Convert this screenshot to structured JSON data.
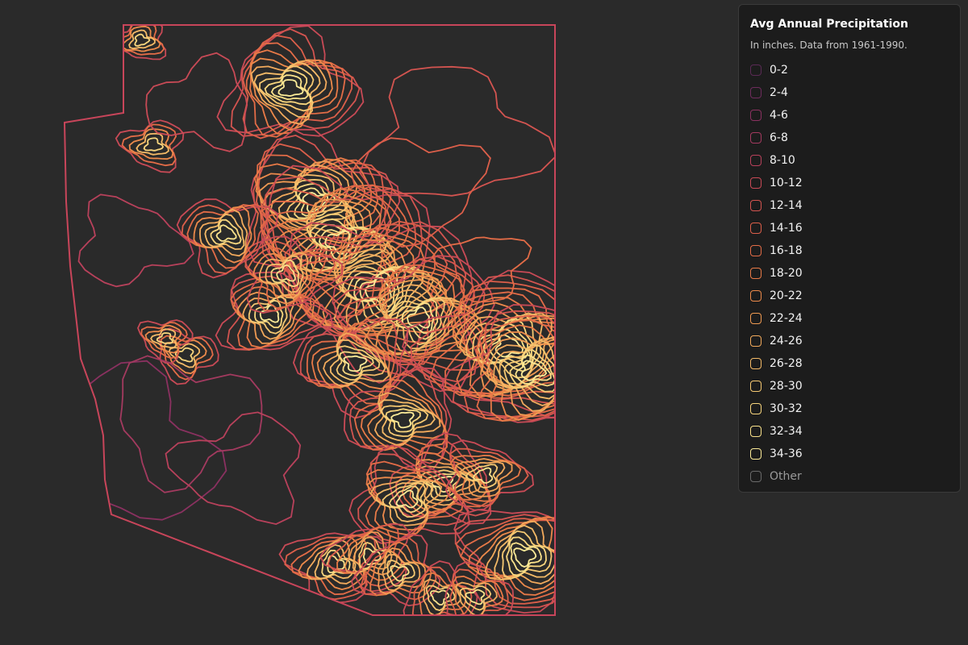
{
  "legend": {
    "title": "Avg Annual Precipitation",
    "subtitle": "In inches. Data from 1961-1990.",
    "items": [
      {
        "label": "0-2",
        "color": "#5a2a55"
      },
      {
        "label": "2-4",
        "color": "#6e2c5c"
      },
      {
        "label": "4-6",
        "color": "#8a3160"
      },
      {
        "label": "6-8",
        "color": "#a33a5f"
      },
      {
        "label": "8-10",
        "color": "#b8415b"
      },
      {
        "label": "10-12",
        "color": "#c84a56"
      },
      {
        "label": "12-14",
        "color": "#d35450"
      },
      {
        "label": "14-16",
        "color": "#dc5f4a"
      },
      {
        "label": "16-18",
        "color": "#e36c47"
      },
      {
        "label": "18-20",
        "color": "#e87a47"
      },
      {
        "label": "20-22",
        "color": "#ec8a4b"
      },
      {
        "label": "22-24",
        "color": "#ef9a52"
      },
      {
        "label": "24-26",
        "color": "#f2aa5c"
      },
      {
        "label": "26-28",
        "color": "#f4ba67"
      },
      {
        "label": "28-30",
        "color": "#f6c972"
      },
      {
        "label": "30-32",
        "color": "#f8d67e"
      },
      {
        "label": "32-34",
        "color": "#fae28b"
      },
      {
        "label": "34-36",
        "color": "#fceb98"
      },
      {
        "label": "Other",
        "color": "#6a6a6a"
      }
    ]
  }
}
